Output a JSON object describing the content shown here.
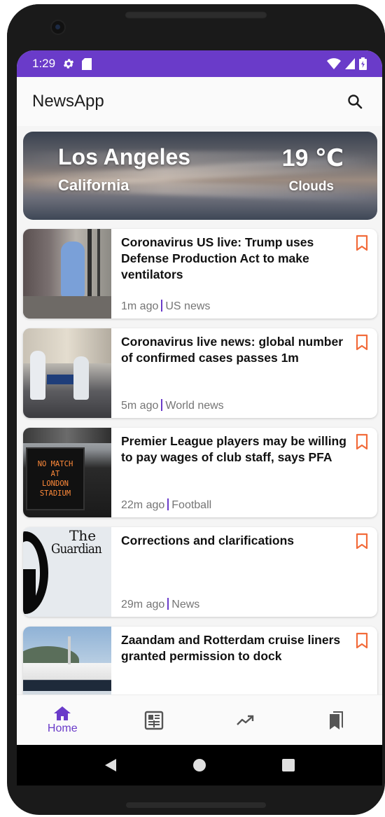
{
  "status_bar": {
    "time": "1:29"
  },
  "app_bar": {
    "title": "NewsApp"
  },
  "weather": {
    "city": "Los Angeles",
    "state": "California",
    "temperature": "19 ℃",
    "condition": "Clouds"
  },
  "news": [
    {
      "title": "Coronavirus US live: Trump uses Defense Production Act to make ventilators",
      "time": "1m ago",
      "section": "US news"
    },
    {
      "title": "Coronavirus live news: global number of confirmed cases passes 1m",
      "time": "5m ago",
      "section": "World news"
    },
    {
      "title": "Premier League players may be willing to pay wages of club staff, says PFA",
      "time": "22m ago",
      "section": "Football"
    },
    {
      "title": "Corrections and clarifications",
      "time": "29m ago",
      "section": "News",
      "thumb_text_1": "The",
      "thumb_text_2": "Guardian"
    },
    {
      "title": "Zaandam and Rotterdam cruise liners granted permission to dock",
      "time": "",
      "section": ""
    }
  ],
  "thumb_sign": [
    "NO MATCH",
    "AT",
    "LONDON",
    "STADIUM"
  ],
  "bottom_nav": {
    "home_label": "Home"
  },
  "colors": {
    "primary": "#6a3bc9",
    "bookmark": "#f26b3a"
  }
}
